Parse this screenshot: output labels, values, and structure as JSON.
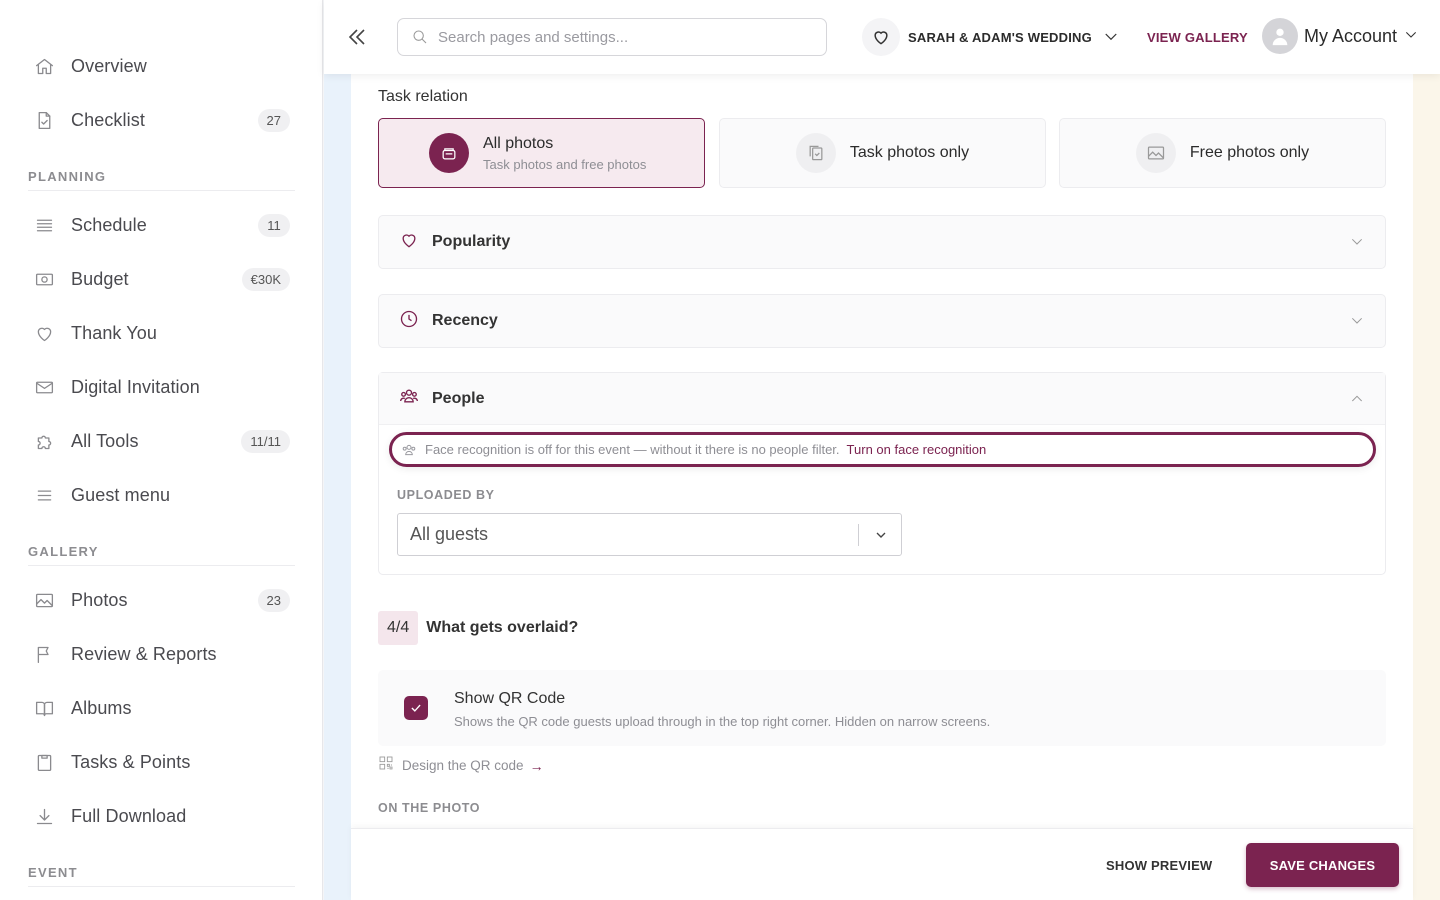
{
  "sidebar": {
    "items": [
      {
        "label": "Overview",
        "icon": "home-icon"
      },
      {
        "label": "Checklist",
        "icon": "document-check-icon",
        "count": "27"
      },
      {
        "label": "Schedule",
        "icon": "list-icon",
        "count": "11"
      },
      {
        "label": "Budget",
        "icon": "money-icon",
        "count": "€30K"
      },
      {
        "label": "Thank You",
        "icon": "heart-icon"
      },
      {
        "label": "Digital Invitation",
        "icon": "envelope-icon"
      },
      {
        "label": "All Tools",
        "icon": "puzzle-icon",
        "count": "11/11"
      },
      {
        "label": "Guest menu",
        "icon": "menu-icon"
      },
      {
        "label": "Photos",
        "icon": "image-icon",
        "count": "23"
      },
      {
        "label": "Review & Reports",
        "icon": "flag-icon"
      },
      {
        "label": "Albums",
        "icon": "book-icon"
      },
      {
        "label": "Tasks & Points",
        "icon": "clipboard-icon"
      },
      {
        "label": "Full Download",
        "icon": "download-icon"
      }
    ],
    "sections": {
      "planning": "PLANNING",
      "gallery": "GALLERY",
      "event": "EVENT"
    }
  },
  "header": {
    "search_placeholder": "Search pages and settings...",
    "event_name": "SARAH & ADAM'S WEDDING",
    "view_gallery": "VIEW GALLERY",
    "account": "My Account"
  },
  "content": {
    "task_relation": "Task relation",
    "options": [
      {
        "title": "All photos",
        "subtitle": "Task photos and free photos",
        "selected": true
      },
      {
        "title": "Task photos only",
        "selected": false
      },
      {
        "title": "Free photos only",
        "selected": false
      }
    ],
    "filters": {
      "popularity": "Popularity",
      "recency": "Recency",
      "people": "People"
    },
    "face_note": {
      "text": "Face recognition is off for this event — without it there is no people filter.",
      "link": "Turn on face recognition"
    },
    "uploaded_by": {
      "label": "UPLOADED BY",
      "value": "All guests"
    },
    "step": {
      "badge": "4/4",
      "title": "What gets overlaid?"
    },
    "qr": {
      "checked": true,
      "title": "Show QR Code",
      "subtitle": "Shows the QR code guests upload through in the top right corner. Hidden on narrow screens."
    },
    "design_link": "Design the QR code",
    "design_arrow": "→",
    "on_photo": "ON THE PHOTO"
  },
  "footer": {
    "preview": "SHOW PREVIEW",
    "save": "SAVE CHANGES"
  },
  "colors": {
    "accent": "#7b2350",
    "accent_light": "#f6eaef"
  }
}
